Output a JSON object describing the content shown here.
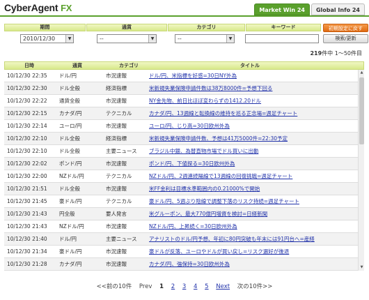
{
  "header": {
    "logo_text": "CyberAgent",
    "logo_fx": "FX",
    "tabs": [
      {
        "label": "Market Win 24",
        "active": true
      },
      {
        "label": "Global Info 24",
        "active": false
      }
    ]
  },
  "filter": {
    "headers": [
      "期間",
      "通貨",
      "カテゴリ",
      "キーワード"
    ],
    "date_value": "2010/12/30",
    "currency_value": "--",
    "category_value": "--",
    "keyword_value": "",
    "reset_button": "初期設定に戻す",
    "search_button": "検索/更新"
  },
  "count": {
    "total": "219",
    "suffix": "件中 1〜50件目"
  },
  "table": {
    "columns": [
      "日時",
      "通貨",
      "カテゴリ",
      "タイトル"
    ],
    "rows": [
      {
        "datetime": "10/12/30 22:35",
        "currency": "ドル/円",
        "category": "市況速報",
        "title": "ドル/円、米指標を好感=30日NY外為"
      },
      {
        "datetime": "10/12/30 22:30",
        "currency": "ドル全般",
        "category": "経済指標",
        "title": "米新規失業保険申請件数は38万8000件=予想下回る"
      },
      {
        "datetime": "10/12/30 22:22",
        "currency": "通貨全般",
        "category": "市況速報",
        "title": "NY金先物、前日比ほぼ変わらずの1412.20ドル"
      },
      {
        "datetime": "10/12/30 22:15",
        "currency": "カナダ/円",
        "category": "テクニカル",
        "title": "カナダ/円、13週線と転換線の維持を巡る正念場=週足チャート"
      },
      {
        "datetime": "10/12/30 22:14",
        "currency": "ユーロ/円",
        "category": "市況速報",
        "title": "ユーロ/円、じり高=30日欧州外為"
      },
      {
        "datetime": "10/12/30 22:10",
        "currency": "ドル全般",
        "category": "経済指標",
        "title": "米新規失業保険申請件数、予想は41万5000件=22:30予定"
      },
      {
        "datetime": "10/12/30 22:10",
        "currency": "ドル全般",
        "category": "主要ニュース",
        "title": "ブラジル中銀、為替直物市場でドル買いに出動"
      },
      {
        "datetime": "10/12/30 22:02",
        "currency": "ポンド/円",
        "category": "市況速報",
        "title": "ポンド/円、下値探る=30日欧州外為"
      },
      {
        "datetime": "10/12/30 22:00",
        "currency": "NZドル/円",
        "category": "テクニカル",
        "title": "NZドル/円、2週連続陽線で13週線の回復挑戦=週足チャート"
      },
      {
        "datetime": "10/12/30 21:51",
        "currency": "ドル全般",
        "category": "市況速報",
        "title": "米FF金利は目標水準範囲内の0.21000%で開始"
      },
      {
        "datetime": "10/12/30 21:45",
        "currency": "豪ドル/円",
        "category": "テクニカル",
        "title": "豪ドル/円、5週ぶり陰線で調整下落のリスク持続=週足チャート"
      },
      {
        "datetime": "10/12/30 21:43",
        "currency": "円全般",
        "category": "要人発言",
        "title": "米グルーポン、最大770億円増資を検討=日経新聞"
      },
      {
        "datetime": "10/12/30 21:43",
        "currency": "NZドル/円",
        "category": "市況速報",
        "title": "NZドル/円、上昇続く=30日欧州外為"
      },
      {
        "datetime": "10/12/30 21:40",
        "currency": "ドル/円",
        "category": "主要ニュース",
        "title": "アナリストのドル/円予想、年初に80円突破も年末には91円台へ=産経"
      },
      {
        "datetime": "10/12/30 21:34",
        "currency": "豪ドル/円",
        "category": "市況速報",
        "title": "豪ドルが反落、ユーロやドルが買い戻し=リスク選好が後退"
      },
      {
        "datetime": "10/12/30 21:28",
        "currency": "カナダ/円",
        "category": "市況速報",
        "title": "カナダ/円、強保持=30日欧州外為"
      }
    ]
  },
  "pager": {
    "prev_label": "<<前の10件",
    "prev_short": "Prev",
    "pages": [
      "1",
      "2",
      "3",
      "4",
      "5"
    ],
    "current": "1",
    "next_short": "Next",
    "next_label": "次の10件>>"
  }
}
